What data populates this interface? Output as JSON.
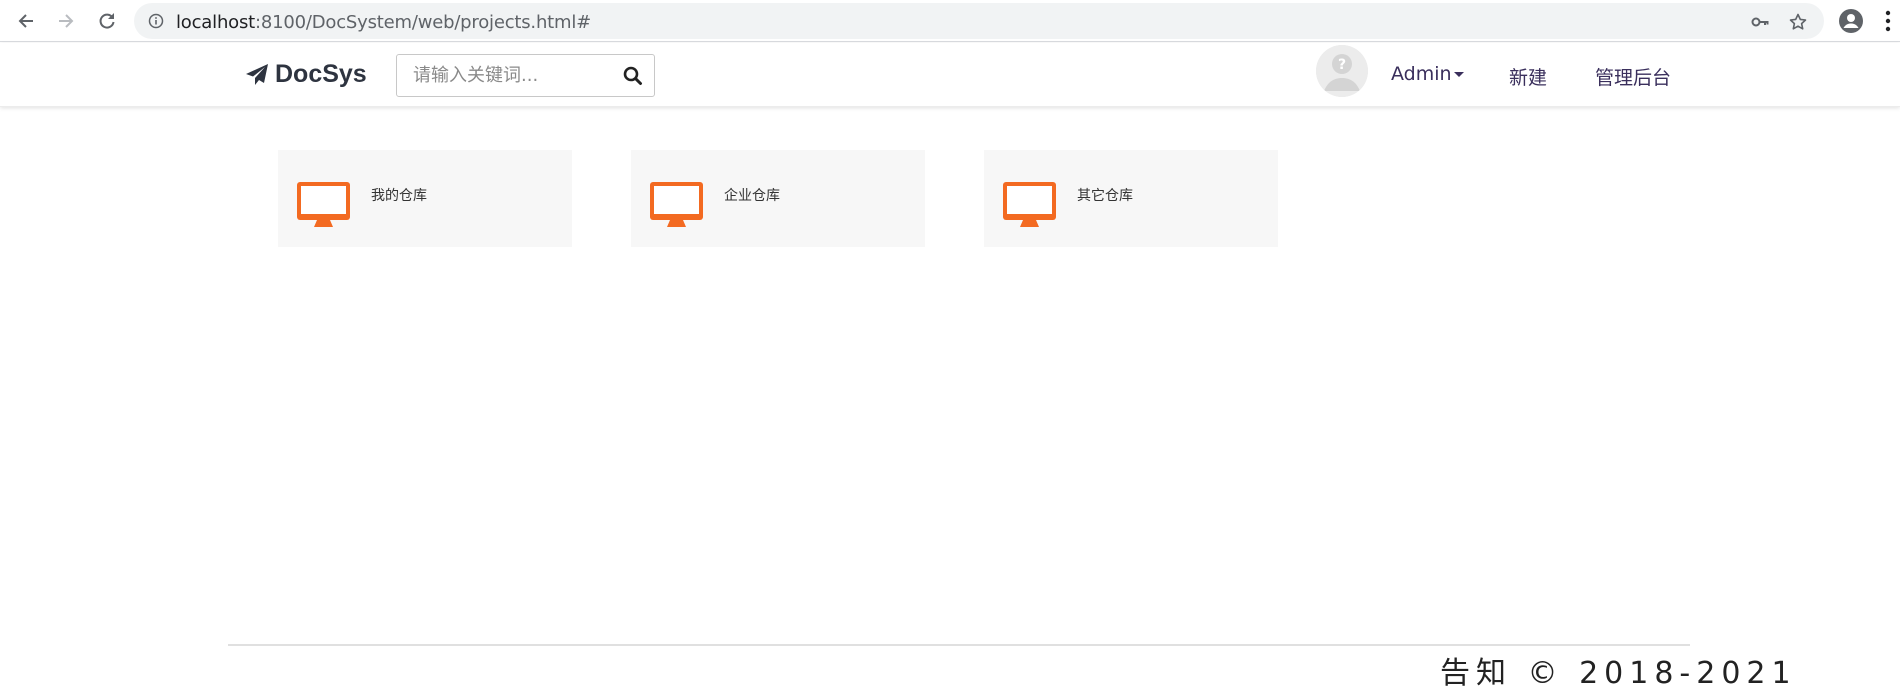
{
  "browser": {
    "url_host": "localhost",
    "url_path": ":8100/DocSystem/web/projects.html#",
    "icons": [
      "back-arrow-icon",
      "forward-arrow-icon",
      "reload-icon",
      "info-icon",
      "key-icon",
      "star-icon",
      "account-circle-icon",
      "more-vert-icon"
    ]
  },
  "navbar": {
    "brand": "DocSys",
    "search_placeholder": "请输入关键词...",
    "user_menu": "Admin",
    "new_link": "新建",
    "admin_link": "管理后台"
  },
  "cards": [
    {
      "label": "我的仓库"
    },
    {
      "label": "企业仓库"
    },
    {
      "label": "其它仓库"
    }
  ],
  "footer": {
    "text": "告知  ©  2018-2021"
  },
  "colors": {
    "accent": "#f36a21",
    "nav_text": "#3a2f5c",
    "card_bg": "#f7f7f7"
  }
}
